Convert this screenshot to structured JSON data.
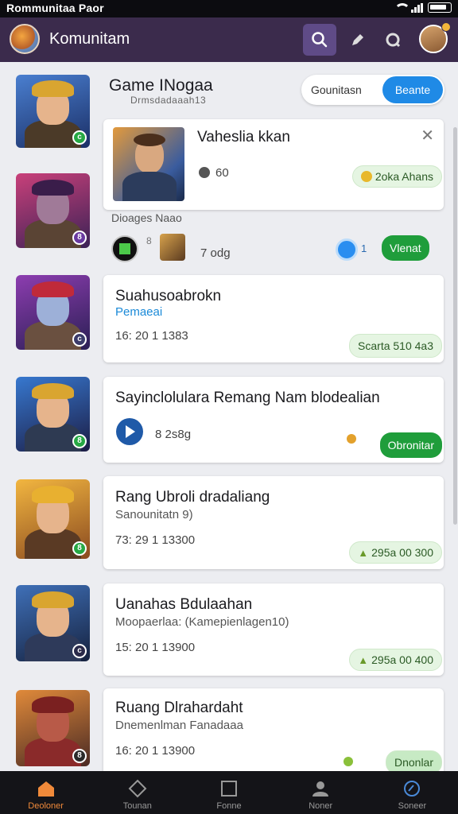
{
  "status_bar": {
    "title": "Rommunitaa Paor"
  },
  "header": {
    "title": "Komunitam"
  },
  "section": {
    "title": "Game INogaa",
    "subtitle": "Drmsdadaaah13",
    "tabs": {
      "inactive": "Gounitasn",
      "active": "Beante"
    }
  },
  "featured": {
    "title": "Vaheslia kkan",
    "count": "60",
    "pill": "2oka Ahans",
    "row_label": "Dioages Naao",
    "row_count": "7 odg",
    "button": "Vlenat"
  },
  "cards": [
    {
      "title": "Suahusoabrokn",
      "sub": "Pemaeai",
      "meta": "16: 20  1 1383",
      "pill": "Scarta 510 4a3"
    },
    {
      "title": "Sayinclolulara Remang Nam blodealian",
      "meta": "8 2s8g",
      "button": "Obronitar"
    },
    {
      "title": "Rang Ubroli dradaliang",
      "sub": "Sanounitatn 9)",
      "meta": "73: 29  1 13300",
      "pill": "295a 00  300"
    },
    {
      "title": "Uanahas Bdulaahan",
      "sub": "Moopaerlaa: (Kamepienlagen10)",
      "meta": "15: 20  1 13900",
      "pill": "295a 00  400"
    },
    {
      "title": "Ruang Dlrahardaht",
      "sub": "Dnemenlman Fanadaaa",
      "meta": "16: 20  1 13900",
      "button": "Dnonlar"
    }
  ],
  "bottom_nav": [
    {
      "label": "Deoloner",
      "icon": "home-icon",
      "active": true
    },
    {
      "label": "Tounan",
      "icon": "diamond-icon",
      "active": false
    },
    {
      "label": "Fonne",
      "icon": "square-icon",
      "active": false
    },
    {
      "label": "Noner",
      "icon": "profile-icon",
      "active": false
    },
    {
      "label": "Soneer",
      "icon": "compass-icon",
      "active": false
    }
  ],
  "colors": {
    "header": "#3b2b4c",
    "accent_green": "#1f9d3b",
    "accent_blue": "#1f8ae6",
    "nav_active": "#f08a3a"
  }
}
